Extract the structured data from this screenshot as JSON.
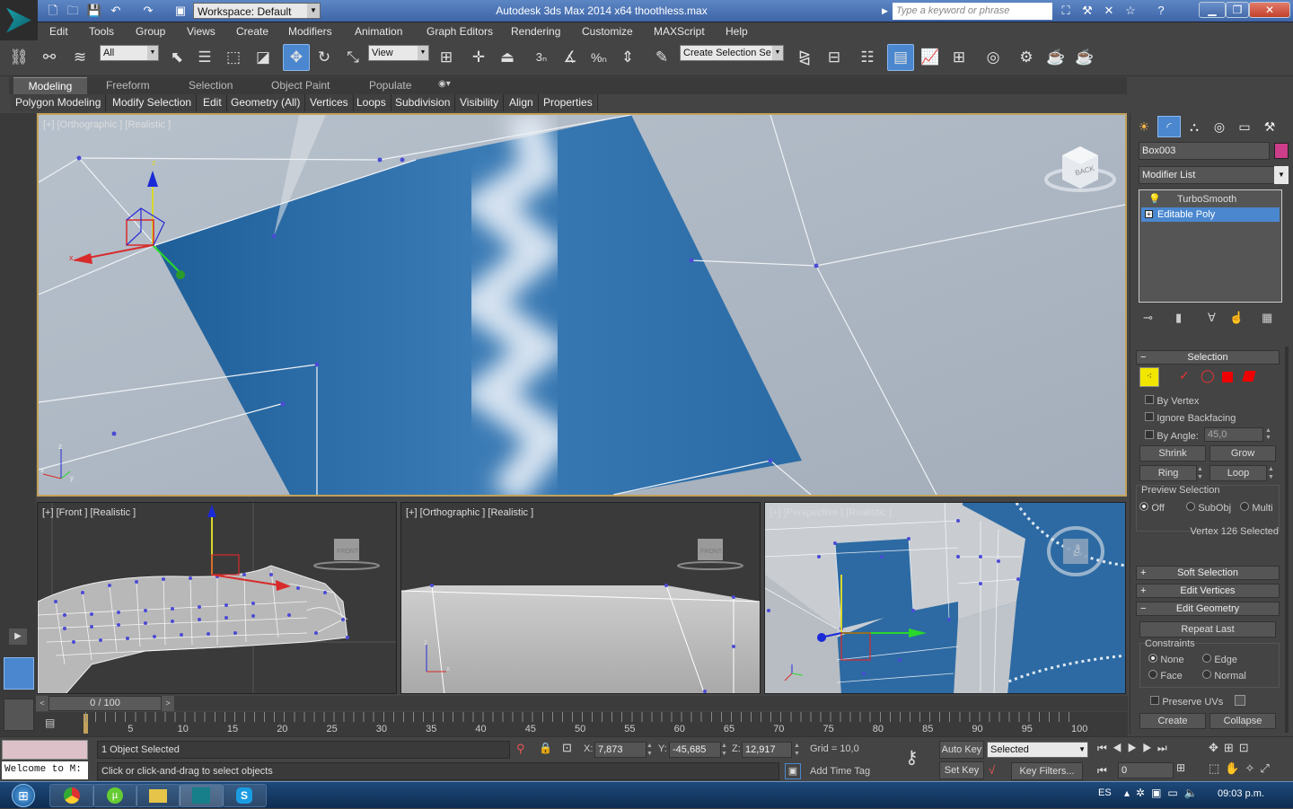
{
  "window": {
    "title": "Autodesk 3ds Max  2014 x64      thoothless.max",
    "workspace": "Workspace: Default",
    "search_placeholder": "Type a keyword or phrase"
  },
  "menu": [
    "Edit",
    "Tools",
    "Group",
    "Views",
    "Create",
    "Modifiers",
    "Animation",
    "Graph Editors",
    "Rendering",
    "Customize",
    "MAXScript",
    "Help"
  ],
  "toolbar": {
    "filter": "All",
    "ref_coord": "View",
    "selection_set": "Create Selection Se"
  },
  "ribbon": {
    "tabs": [
      "Modeling",
      "Freeform",
      "Selection",
      "Object Paint",
      "Populate"
    ],
    "panels": [
      "Polygon Modeling",
      "Modify Selection",
      "Edit",
      "Geometry (All)",
      "Vertices",
      "Loops",
      "Subdivision",
      "Visibility",
      "Align",
      "Properties"
    ]
  },
  "viewports": {
    "top": "[+] [Orthographic ] [Realistic ]",
    "front": "[+] [Front ] [Realistic ]",
    "ortho2": "[+] [Orthographic ] [Realistic ]",
    "persp": "[+] [Perspective ] [Realistic ]",
    "cube_back": "BACK",
    "cube_front": "FRONT",
    "cube_top": "TOP"
  },
  "command_panel": {
    "object_name": "Box003",
    "modifier_list": "Modifier List",
    "stack": [
      "TurboSmooth",
      "Editable Poly"
    ],
    "selection": {
      "title": "Selection",
      "by_vertex": "By Vertex",
      "ignore_backfacing": "Ignore Backfacing",
      "by_angle": "By Angle:",
      "angle_value": "45,0",
      "shrink": "Shrink",
      "grow": "Grow",
      "ring": "Ring",
      "loop": "Loop",
      "preview_title": "Preview Selection",
      "preview_off": "Off",
      "preview_subobj": "SubObj",
      "preview_multi": "Multi",
      "status": "Vertex 126 Selected"
    },
    "rollouts": {
      "soft": "Soft Selection",
      "edit_vertices": "Edit Vertices",
      "edit_geometry": "Edit Geometry"
    },
    "edit_geometry": {
      "repeat_last": "Repeat Last",
      "constraints": "Constraints",
      "none": "None",
      "edge": "Edge",
      "face": "Face",
      "normal": "Normal",
      "preserve_uvs": "Preserve UVs",
      "create": "Create",
      "collapse": "Collapse"
    }
  },
  "timeline": {
    "frame": "0 / 100",
    "ticks": [
      "5",
      "10",
      "15",
      "20",
      "25",
      "30",
      "35",
      "40",
      "45",
      "50",
      "55",
      "60",
      "65",
      "70",
      "75",
      "80",
      "85",
      "90",
      "95",
      "100"
    ]
  },
  "status": {
    "selected": "1 Object Selected",
    "prompt": "Click or click-and-drag to select objects",
    "welcome": "Welcome to M:",
    "x_label": "X:",
    "x": "7,873",
    "y_label": "Y:",
    "y": "-45,685",
    "z_label": "Z:",
    "z": "12,917",
    "grid": "Grid = 10,0",
    "add_time_tag": "Add Time Tag",
    "auto_key": "Auto Key",
    "set_key": "Set Key",
    "key_mode": "Selected",
    "key_filters": "Key Filters...",
    "frame_value": "0"
  },
  "taskbar": {
    "lang": "ES",
    "time": "09:03 p.m."
  },
  "colors": {
    "accent": "#4a87cf",
    "viewport_border": "#c2a25a",
    "water": "#2f6fa8",
    "vertex": "#4b4bd6"
  }
}
